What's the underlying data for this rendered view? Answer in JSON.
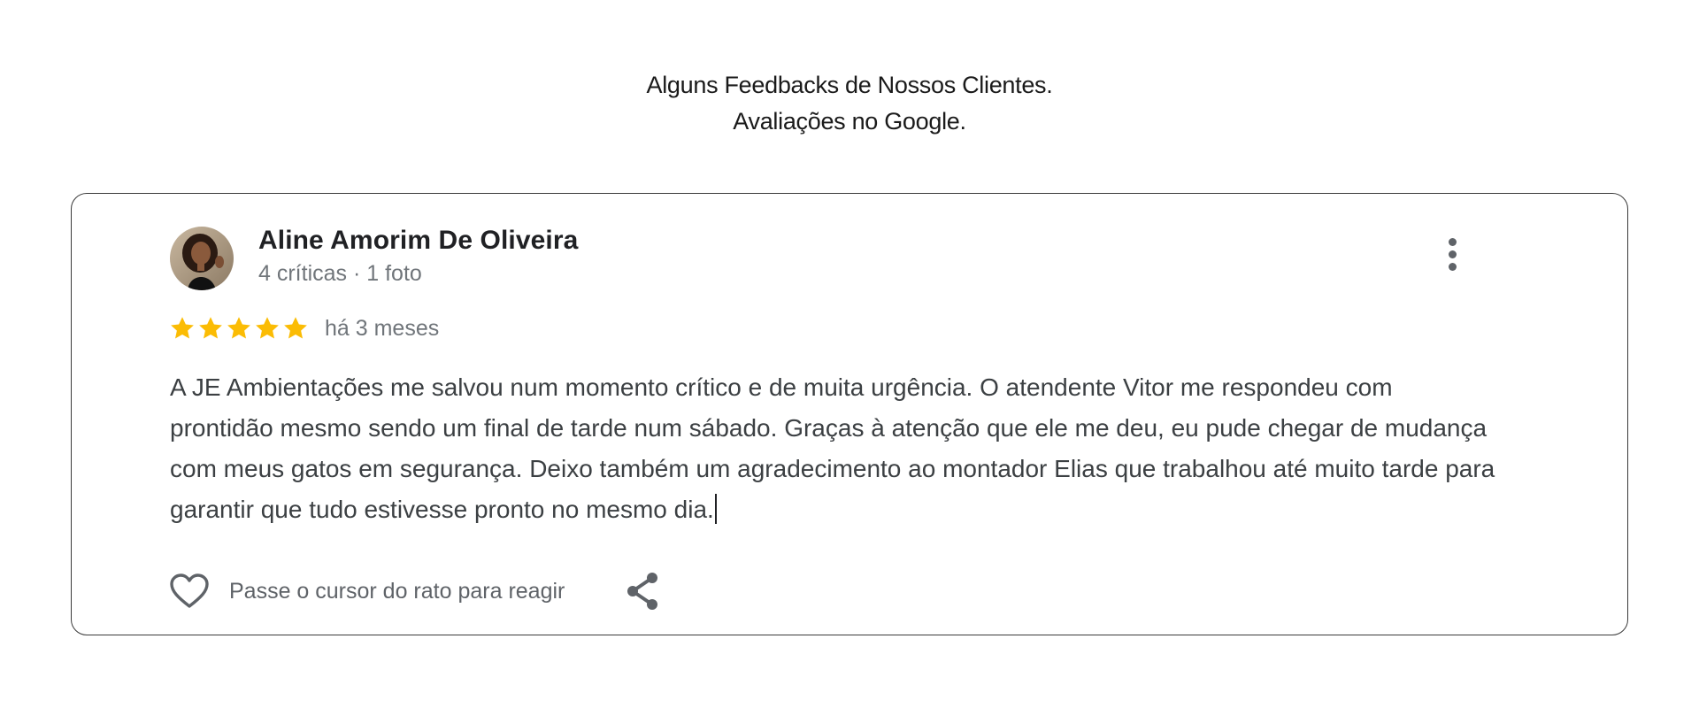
{
  "header": {
    "line1": "Alguns Feedbacks de Nossos Clientes.",
    "line2": "Avaliações no Google."
  },
  "review": {
    "reviewer_name": "Aline Amorim De Oliveira",
    "reviewer_meta": "4 críticas · 1 foto",
    "rating": 5,
    "rating_max": 5,
    "star_color": "#fbbc04",
    "date": "há 3 meses",
    "text": "A JE Ambientações me salvou num momento crítico e de muita urgência. O atendente Vitor me respondeu com prontidão mesmo sendo um final de tarde num sábado. Graças à atenção que ele me deu, eu pude chegar de mudança com meus gatos em segurança. Deixo também um agradecimento ao montador Elias que trabalhou até muito tarde para garantir que tudo estivesse pronto no mesmo dia.",
    "like_label": "Passe o cursor do rato para reagir",
    "icons": {
      "menu": "more-vertical-icon",
      "like": "heart-icon",
      "share": "share-icon"
    }
  }
}
